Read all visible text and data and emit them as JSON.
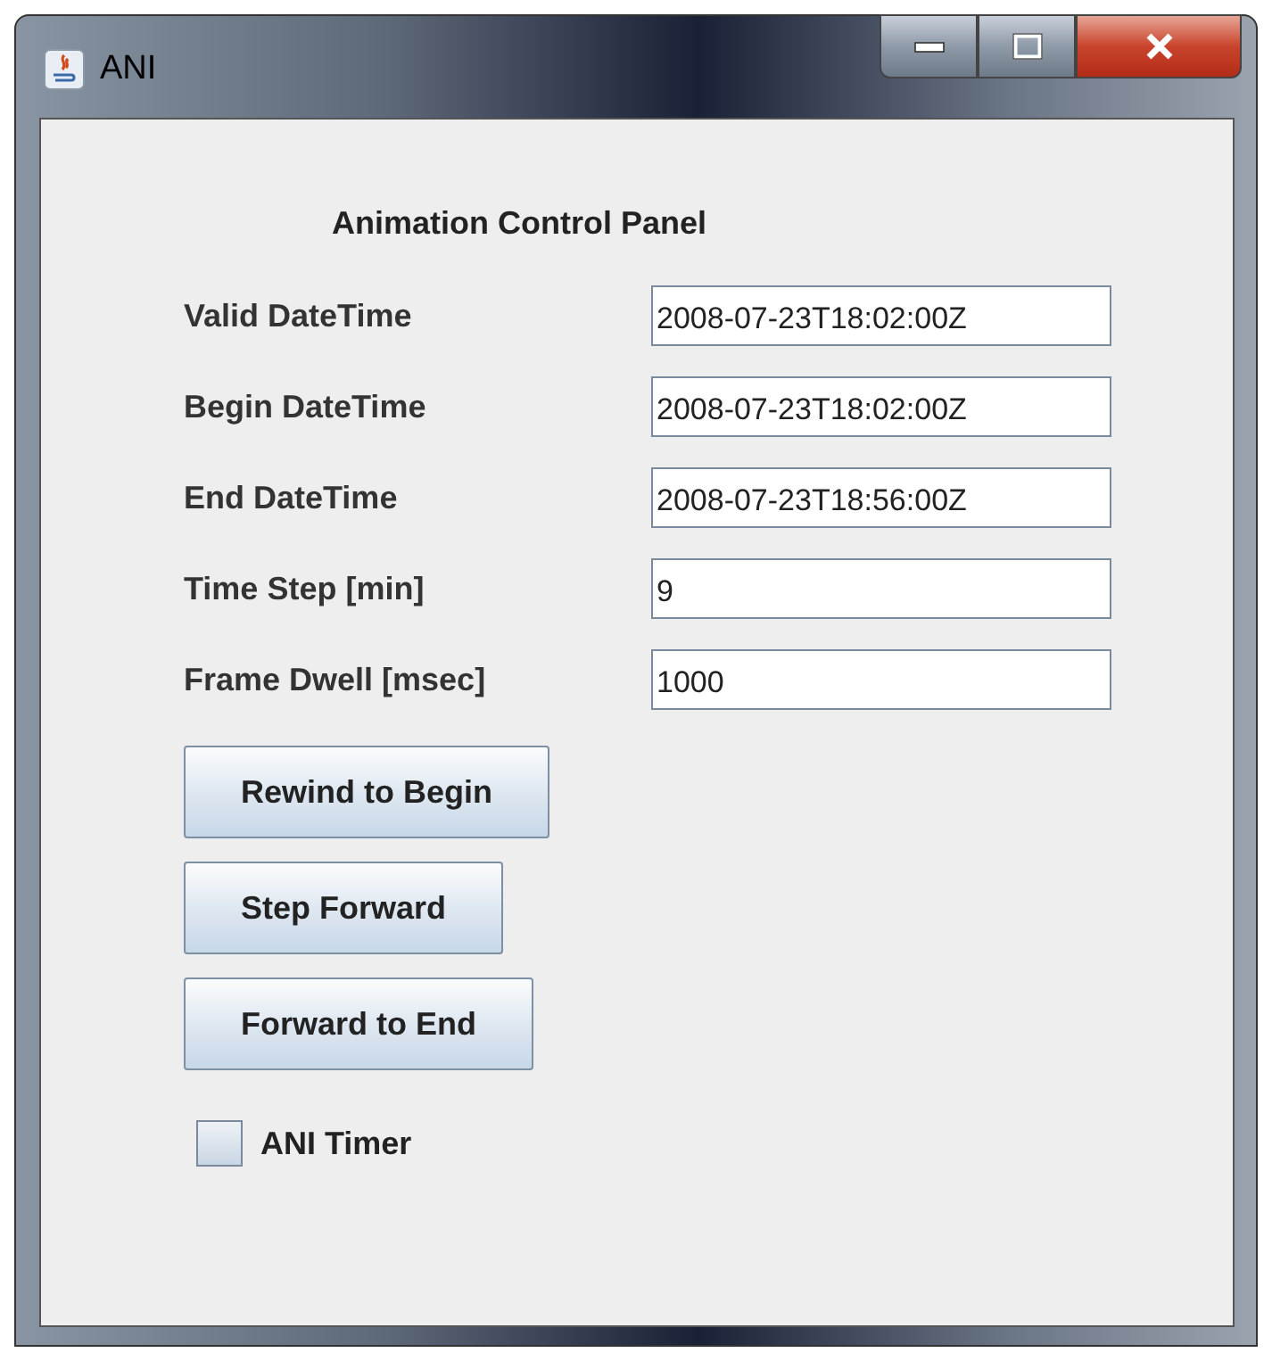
{
  "window": {
    "title": "ANI"
  },
  "heading": "Animation Control Panel",
  "fields": [
    {
      "label": "Valid DateTime",
      "value": "2008-07-23T18:02:00Z"
    },
    {
      "label": "Begin DateTime",
      "value": "2008-07-23T18:02:00Z"
    },
    {
      "label": "End DateTime",
      "value": "2008-07-23T18:56:00Z"
    },
    {
      "label": "Time Step [min]",
      "value": "9"
    },
    {
      "label": "Frame Dwell [msec]",
      "value": "1000"
    }
  ],
  "buttons": [
    {
      "label": "Rewind to Begin"
    },
    {
      "label": "Step Forward"
    },
    {
      "label": "Forward to End"
    }
  ],
  "checkbox": {
    "label": "ANI Timer",
    "checked": false
  }
}
